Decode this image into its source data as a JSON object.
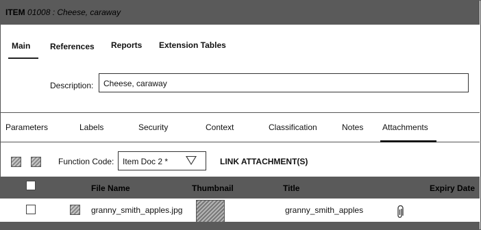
{
  "window": {
    "item_label": "ITEM",
    "item_code": "01008 : Cheese, caraway"
  },
  "main_tabs": [
    {
      "label": "Main"
    },
    {
      "label": "References"
    },
    {
      "label": "Reports"
    },
    {
      "label": "Extension Tables"
    }
  ],
  "description": {
    "label": "Description:",
    "value": "Cheese, caraway"
  },
  "sub_tabs": [
    {
      "label": "Parameters"
    },
    {
      "label": "Labels"
    },
    {
      "label": "Security"
    },
    {
      "label": "Context"
    },
    {
      "label": "Classification"
    },
    {
      "label": "Notes"
    },
    {
      "label": "Attachments"
    }
  ],
  "attachments_toolbar": {
    "function_code_label": "Function Code:",
    "function_code_value": "Item Doc 2 *",
    "link_label": "LINK ATTACHMENT(S)"
  },
  "grid": {
    "headers": {
      "file_name": "File Name",
      "thumbnail": "Thumbnail",
      "title": "Title",
      "expiry_date": "Expiry Date"
    },
    "rows": [
      {
        "file_name": "granny_smith_apples.jpg",
        "title": "granny_smith_apples",
        "expiry_date": ""
      }
    ]
  },
  "icons": {
    "toolbar_icon_1": "image-placeholder-icon",
    "toolbar_icon_2": "image-placeholder-icon",
    "row_icon": "image-placeholder-icon",
    "attachment": "paperclip-icon",
    "function_code_dropdown": "triangle-down-icon"
  },
  "colors": {
    "header_bar": "#5a5a5a",
    "border": "#555555"
  }
}
